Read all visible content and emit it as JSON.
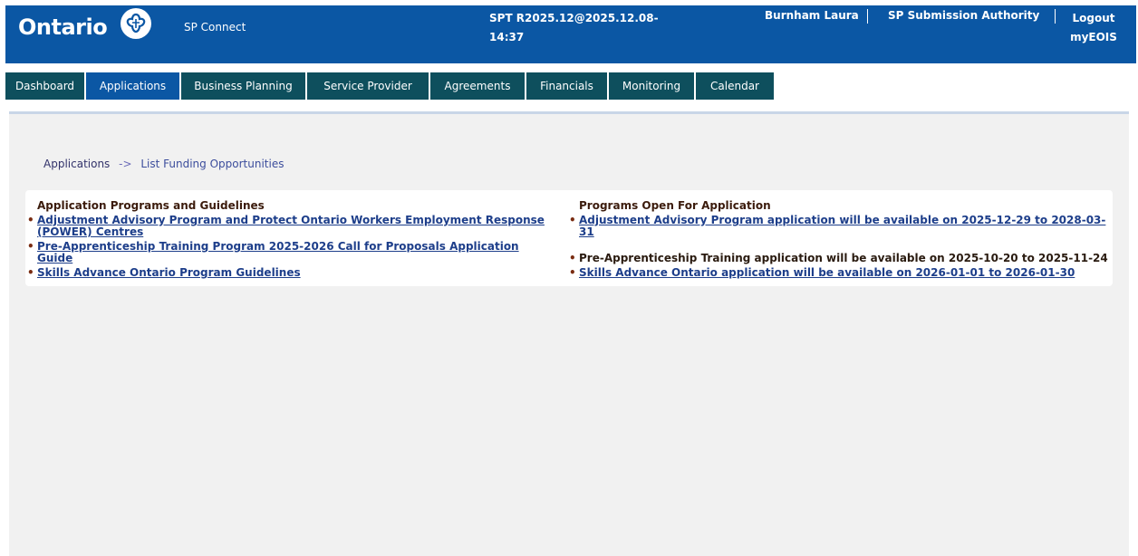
{
  "header": {
    "logo_text": "Ontario",
    "app_name": "SP Connect",
    "version_line1": "SPT R2025.12@2025.12.08-",
    "version_line2": "14:37",
    "user": "Burnham Laura",
    "role": "SP Submission Authority",
    "logout": "Logout",
    "myeois": "myEOIS"
  },
  "nav": {
    "tabs": [
      {
        "label": "Dashboard"
      },
      {
        "label": "Applications"
      },
      {
        "label": "Business Planning"
      },
      {
        "label": "Service Provider"
      },
      {
        "label": "Agreements"
      },
      {
        "label": "Financials"
      },
      {
        "label": "Monitoring"
      },
      {
        "label": "Calendar"
      }
    ]
  },
  "breadcrumb": {
    "root": "Applications",
    "arrow": "->",
    "current": "List Funding Opportunities"
  },
  "left": {
    "title": "Application Programs and Guidelines",
    "items": [
      {
        "text": "Adjustment Advisory Program and Protect Ontario Workers Employment Response (POWER) Centres"
      },
      {
        "text": "Pre-Apprenticeship Training Program 2025-2026 Call for Proposals Application Guide"
      },
      {
        "text": "Skills Advance Ontario Program Guidelines"
      }
    ]
  },
  "right": {
    "title": "Programs Open For Application",
    "items": [
      {
        "text": "Adjustment Advisory Program application will be available on 2025-12-29 to 2028-03-31"
      },
      {
        "text": "Pre-Apprenticeship Training application will be available on 2025-10-20 to 2025-11-24"
      },
      {
        "text": "Skills Advance Ontario application will be available on 2026-01-01 to 2026-01-30"
      }
    ]
  },
  "colors": {
    "header_bg": "#0b57a4",
    "nav_bg": "#0e4f5d",
    "nav_active": "#0b57a4",
    "link": "#1d3e8a"
  }
}
